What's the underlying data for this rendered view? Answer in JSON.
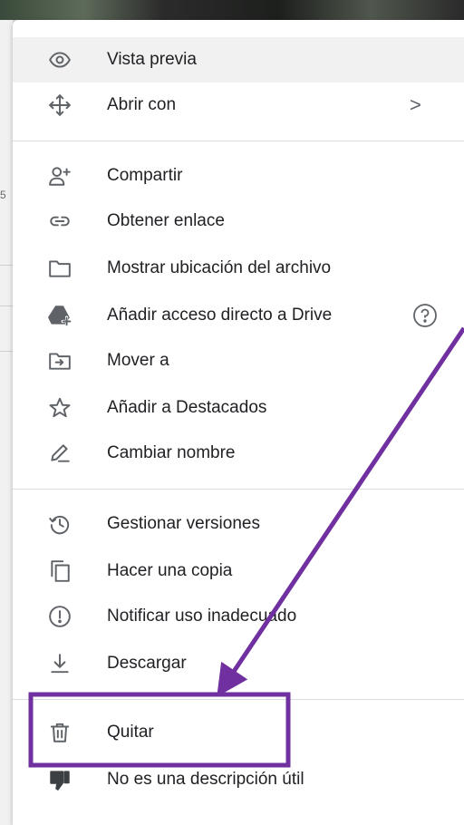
{
  "menu": {
    "items": [
      {
        "label": "Vista previa",
        "icon": "eye-icon"
      },
      {
        "label": "Abrir con",
        "icon": "move-icon",
        "chevron": ">"
      },
      {
        "label": "Compartir",
        "icon": "person-add-icon"
      },
      {
        "label": "Obtener enlace",
        "icon": "link-icon"
      },
      {
        "label": "Mostrar ubicación del archivo",
        "icon": "folder-icon"
      },
      {
        "label": "Añadir acceso directo a Drive",
        "icon": "drive-shortcut-icon"
      },
      {
        "label": "Mover a",
        "icon": "move-to-folder-icon"
      },
      {
        "label": "Añadir a Destacados",
        "icon": "star-icon"
      },
      {
        "label": "Cambiar nombre",
        "icon": "pencil-icon"
      },
      {
        "label": "Gestionar versiones",
        "icon": "history-icon"
      },
      {
        "label": "Hacer una copia",
        "icon": "copy-icon"
      },
      {
        "label": "Notificar uso inadecuado",
        "icon": "alert-icon"
      },
      {
        "label": "Descargar",
        "icon": "download-icon"
      },
      {
        "label": "Quitar",
        "icon": "trash-icon"
      },
      {
        "label": "No es una descripción útil",
        "icon": "thumbs-down-icon"
      }
    ]
  },
  "background": {
    "left_fragment": "5"
  },
  "annotation": {
    "color": "#7030a0"
  }
}
